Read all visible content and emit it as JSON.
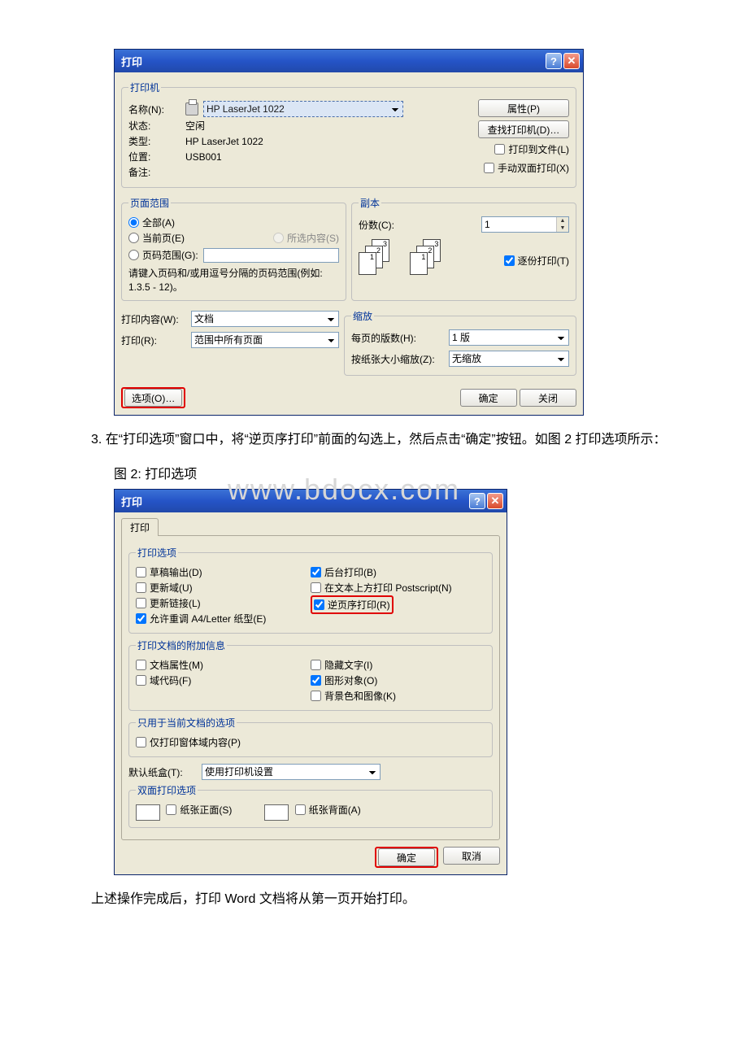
{
  "dlg1": {
    "title": "打印",
    "printer": {
      "legend": "打印机",
      "nameLabel": "名称(N):",
      "nameValue": "HP LaserJet 1022",
      "statusLabel": "状态:",
      "statusValue": "空闲",
      "typeLabel": "类型:",
      "typeValue": "HP LaserJet 1022",
      "locationLabel": "位置:",
      "locationValue": "USB001",
      "commentLabel": "备注:",
      "commentValue": "",
      "propsBtn": "属性(P)",
      "findBtn": "查找打印机(D)…",
      "toFileLabel": "打印到文件(L)",
      "manualDuplexLabel": "手动双面打印(X)"
    },
    "range": {
      "legend": "页面范围",
      "allLabel": "全部(A)",
      "currentLabel": "当前页(E)",
      "selectionLabel": "所选内容(S)",
      "pagesLabel": "页码范围(G):",
      "hint": "请键入页码和/或用逗号分隔的页码范围(例如: 1.3.5 - 12)。"
    },
    "copies": {
      "legend": "副本",
      "countLabel": "份数(C):",
      "countValue": "1",
      "collateLabel": "逐份打印(T)"
    },
    "zoom": {
      "legend": "缩放",
      "ppsLabel": "每页的版数(H):",
      "ppsValue": "1 版",
      "scaleLabel": "按纸张大小缩放(Z):",
      "scaleValue": "无缩放"
    },
    "whatLabel": "打印内容(W):",
    "whatValue": "文档",
    "printLabel": "打印(R):",
    "printValue": "范围中所有页面",
    "optionsBtn": "选项(O)…",
    "okBtn": "确定",
    "closeBtn": "关闭"
  },
  "para1": "3. 在“打印选项”窗口中，将“逆页序打印”前面的勾选上，然后点击“确定”按钮。如图 2 打印选项所示：",
  "fig2caption": "图 2: 打印选项",
  "watermark": "www.bdocx.com",
  "dlg2": {
    "title": "打印",
    "tab": "打印",
    "options": {
      "legend": "打印选项",
      "draftLabel": "草稿输出(D)",
      "updateFieldsLabel": "更新域(U)",
      "updateLinksLabel": "更新链接(L)",
      "allowA4Label": "允许重调 A4/Letter 纸型(E)",
      "bgPrintLabel": "后台打印(B)",
      "psOverTextLabel": "在文本上方打印 Postscript(N)",
      "reverseLabel": "逆页序打印(R)"
    },
    "additional": {
      "legend": "打印文档的附加信息",
      "docPropsLabel": "文档属性(M)",
      "fieldCodesLabel": "域代码(F)",
      "hiddenTextLabel": "隐藏文字(I)",
      "drawObjLabel": "图形对象(O)",
      "bgImageLabel": "背景色和图像(K)"
    },
    "currentDoc": {
      "legend": "只用于当前文档的选项",
      "formsOnlyLabel": "仅打印窗体域内容(P)"
    },
    "trayLabel": "默认纸盒(T):",
    "trayValue": "使用打印机设置",
    "duplex": {
      "legend": "双面打印选项",
      "frontLabel": "纸张正面(S)",
      "backLabel": "纸张背面(A)"
    },
    "okBtn": "确定",
    "cancelBtn": "取消"
  },
  "para2": "上述操作完成后，打印 Word 文档将从第一页开始打印。"
}
